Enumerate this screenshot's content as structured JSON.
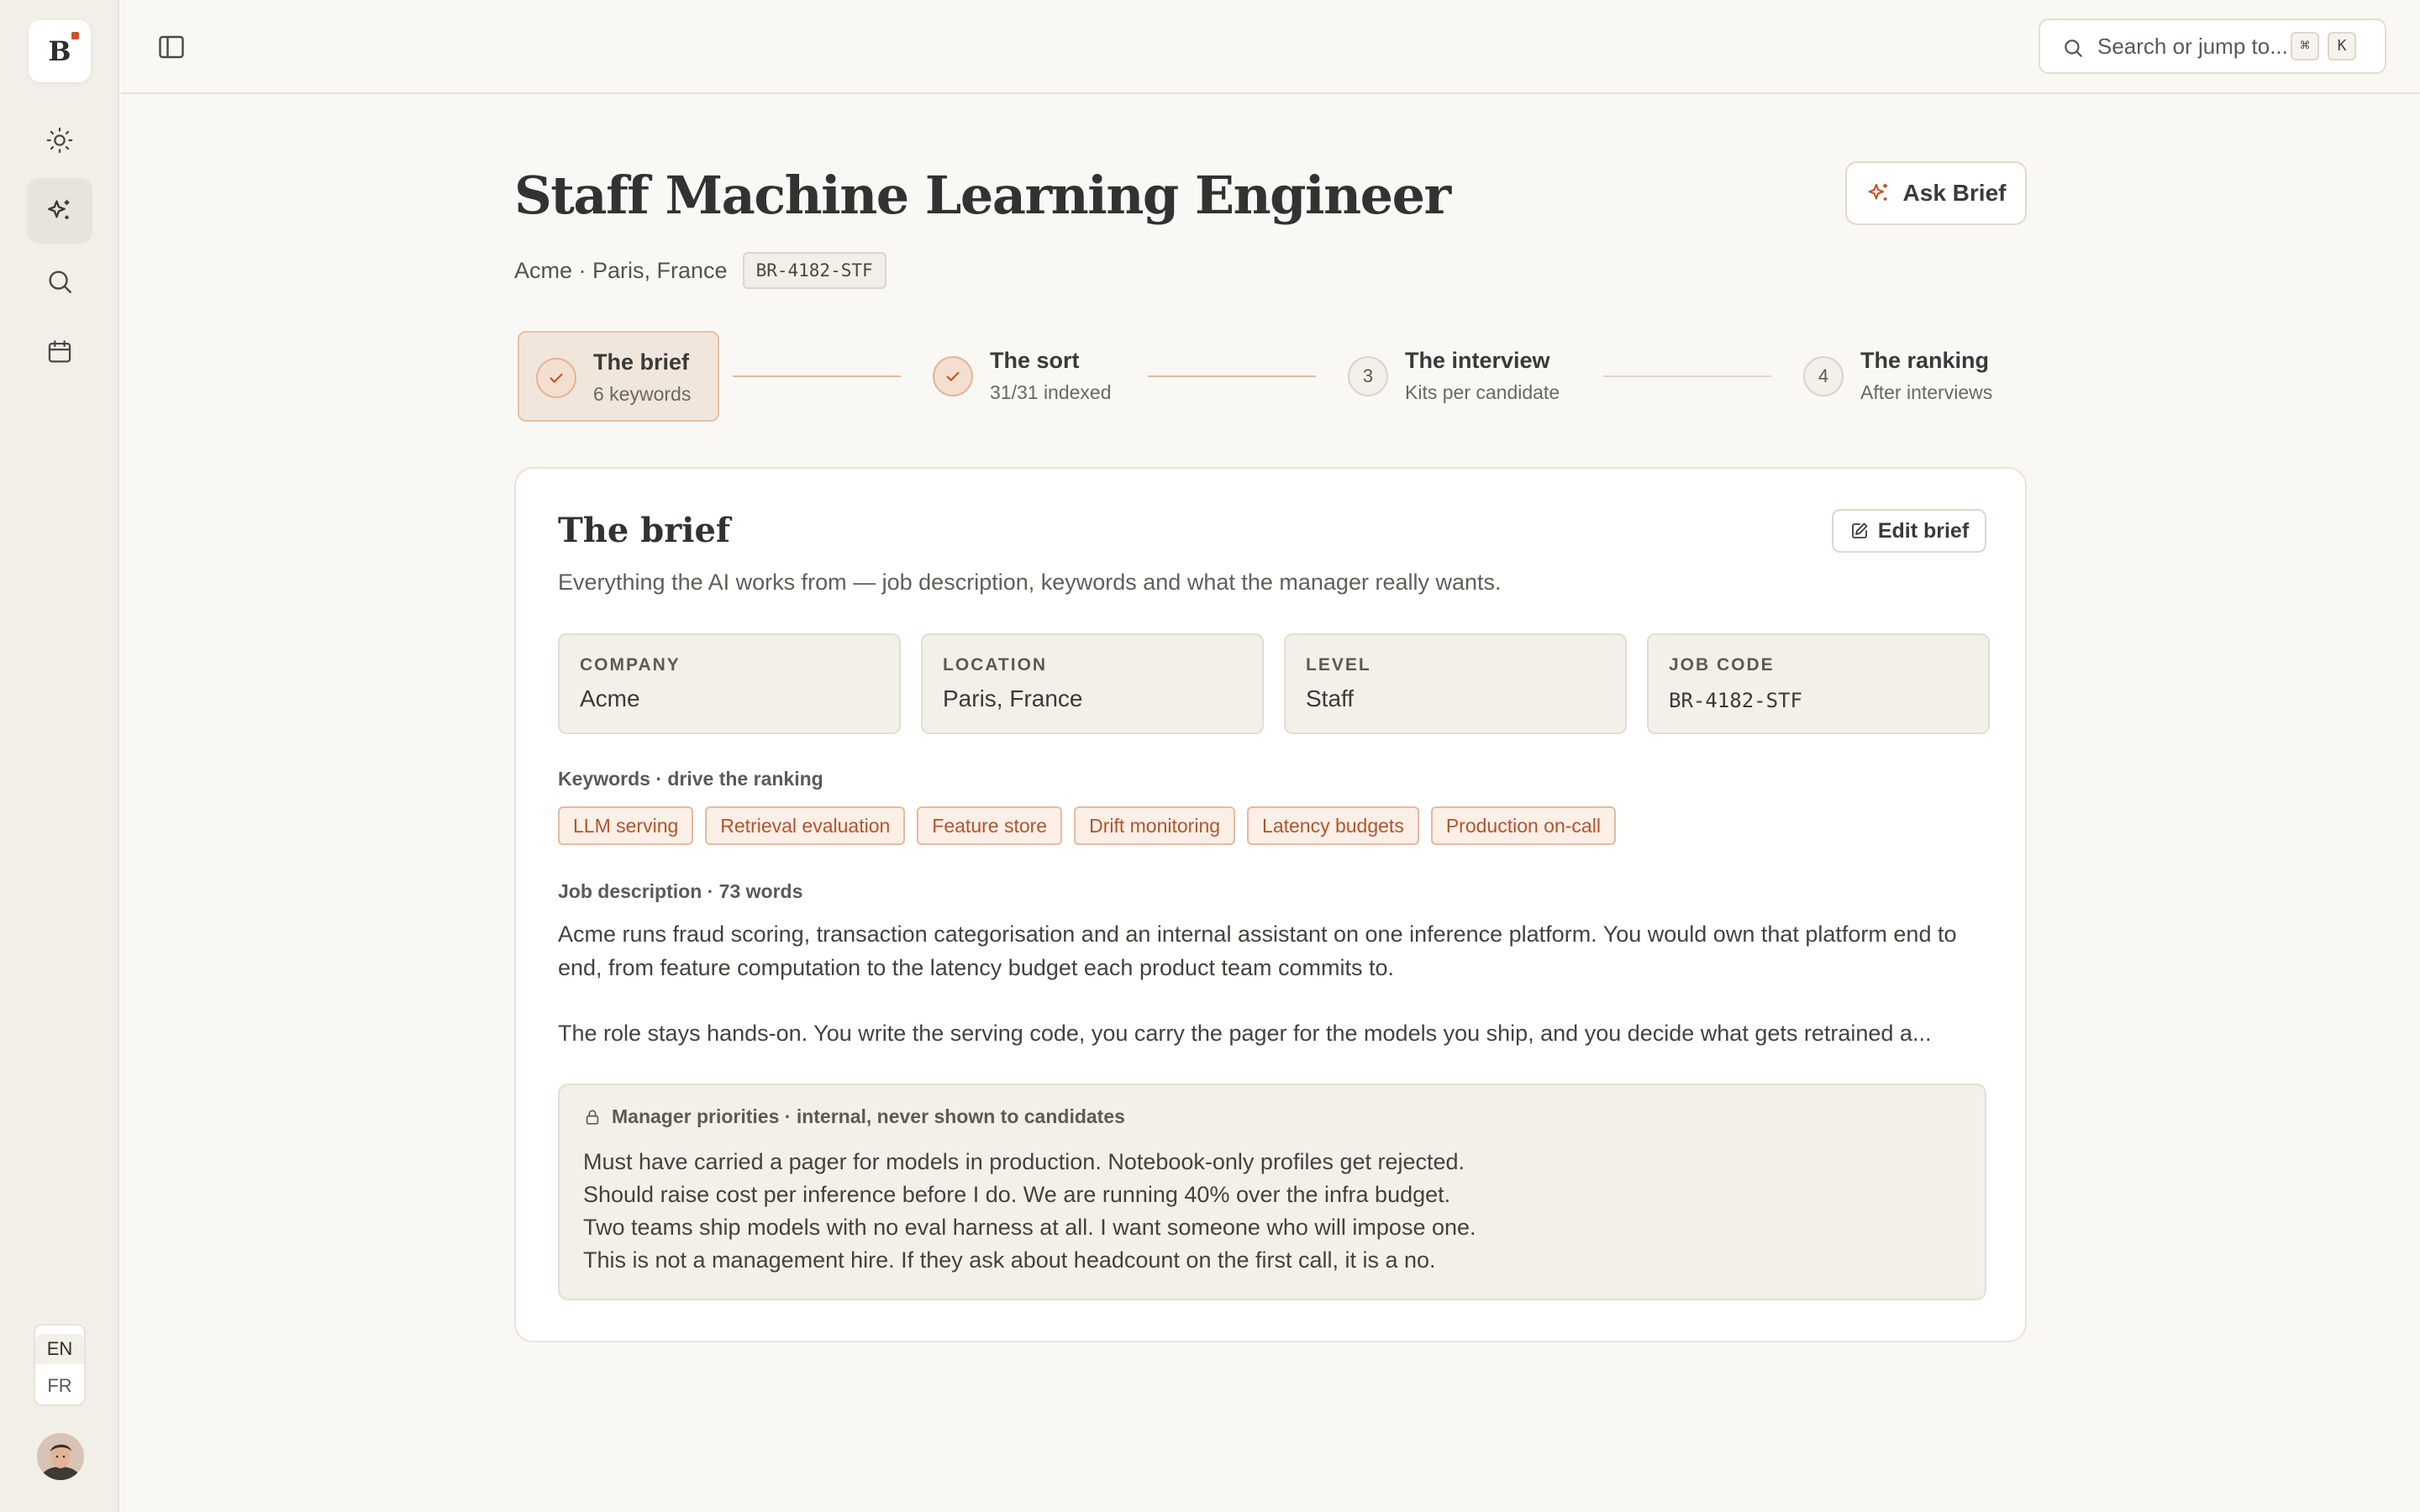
{
  "app": {
    "logo_letter": "B",
    "accent_color": "#d0502a"
  },
  "sidebar": {
    "items": [
      {
        "name": "sun-icon"
      },
      {
        "name": "sparkles-icon",
        "active": true
      },
      {
        "name": "search-icon"
      },
      {
        "name": "calendar-icon"
      }
    ],
    "languages": [
      "EN",
      "FR"
    ],
    "selected_language": "EN"
  },
  "topbar": {
    "search_placeholder": "Search or jump to...",
    "shortcut_keys": [
      "⌘",
      "K"
    ]
  },
  "header": {
    "title": "Staff Machine Learning Engineer",
    "meta": "Acme · Paris, France",
    "job_code": "BR-4182-STF",
    "ask_button": "Ask Brief"
  },
  "steps": [
    {
      "marker": "✓",
      "title": "The brief",
      "subtitle": "6 keywords",
      "state": "current"
    },
    {
      "marker": "✓",
      "title": "The sort",
      "subtitle": "31/31 indexed",
      "state": "done"
    },
    {
      "marker": "3",
      "title": "The interview",
      "subtitle": "Kits per candidate",
      "state": "todo"
    },
    {
      "marker": "4",
      "title": "The ranking",
      "subtitle": "After interviews",
      "state": "todo"
    }
  ],
  "brief": {
    "title": "The brief",
    "subtitle": "Everything the AI works from — job description, keywords and what the manager really wants.",
    "edit_button": "Edit brief",
    "fields": [
      {
        "label": "COMPANY",
        "value": "Acme"
      },
      {
        "label": "LOCATION",
        "value": "Paris, France"
      },
      {
        "label": "LEVEL",
        "value": "Staff"
      },
      {
        "label": "JOB CODE",
        "value": "BR-4182-STF"
      }
    ],
    "keywords_label": "Keywords · drive the ranking",
    "keywords": [
      "LLM serving",
      "Retrieval evaluation",
      "Feature store",
      "Drift monitoring",
      "Latency budgets",
      "Production on-call"
    ],
    "job_description_label": "Job description · 73 words",
    "job_description": [
      "Acme runs fraud scoring, transaction categorisation and an internal assistant on one inference platform. You would own that platform end to end, from feature computation to the latency budget each product team commits to.",
      "The role stays hands-on. You write the serving code, you carry the pager for the models you ship, and you decide what gets retrained a..."
    ],
    "priorities_label": "Manager priorities · internal, never shown to candidates",
    "priorities": [
      "Must have carried a pager for models in production. Notebook-only profiles get rejected.",
      "Should raise cost per inference before I do. We are running 40% over the infra budget.",
      "Two teams ship models with no eval harness at all. I want someone who will impose one.",
      "This is not a management hire. If they ask about headcount on the first call, it is a no."
    ]
  }
}
